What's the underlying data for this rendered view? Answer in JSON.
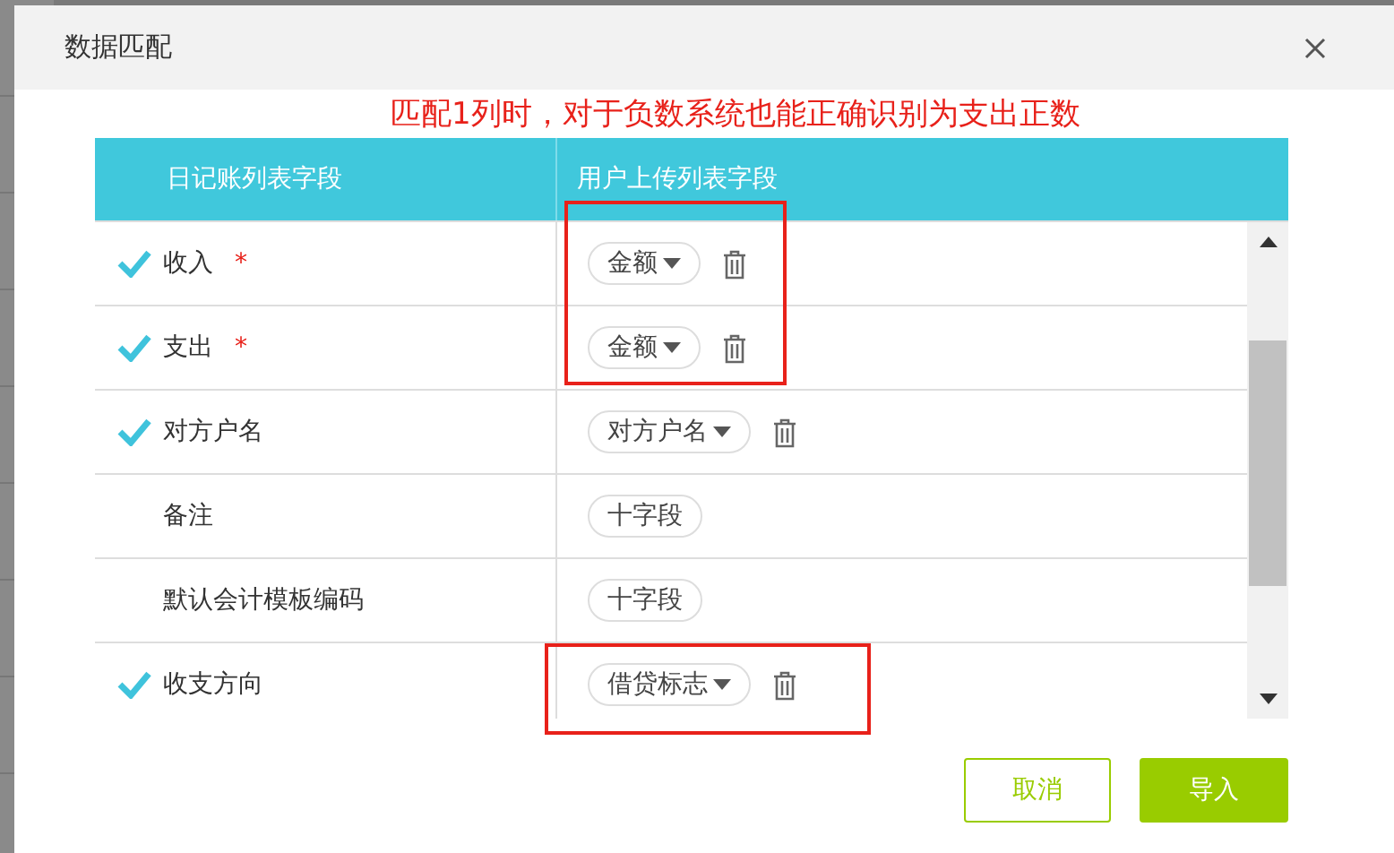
{
  "dialog": {
    "title": "数据匹配"
  },
  "annotation": "匹配1列时，对于负数系统也能正确识别为支出正数",
  "table": {
    "columns": [
      "日记账列表字段",
      "用户上传列表字段"
    ],
    "rows": [
      {
        "checked": true,
        "label": "收入",
        "mark": "*",
        "field": {
          "kind": "select",
          "text": "金额"
        }
      },
      {
        "checked": true,
        "label": "支出",
        "mark": "*",
        "field": {
          "kind": "select",
          "text": "金额"
        }
      },
      {
        "checked": true,
        "label": "对方户名",
        "field": {
          "kind": "select",
          "text": "对方户名"
        }
      },
      {
        "checked": false,
        "label": "备注",
        "field": {
          "kind": "add",
          "text": "十字段"
        }
      },
      {
        "checked": false,
        "label": "默认会计模板编码",
        "field": {
          "kind": "add",
          "text": "十字段"
        }
      },
      {
        "checked": true,
        "label": "收支方向",
        "field": {
          "kind": "select",
          "text": "借贷标志"
        }
      }
    ]
  },
  "buttons": [
    {
      "kind": "secondary",
      "label": "取消"
    },
    {
      "kind": "primary",
      "label": "导入"
    }
  ]
}
